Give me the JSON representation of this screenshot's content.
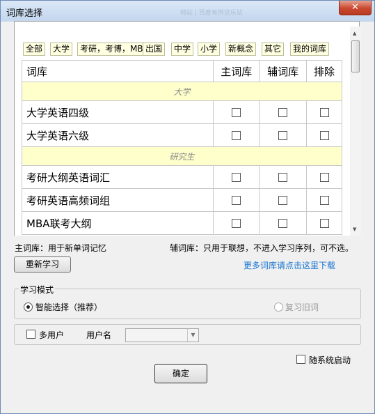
{
  "window": {
    "title": "词库选择",
    "ghost_text": "网站 | 百度有所见乐站",
    "close_glyph": "✕"
  },
  "filters": [
    "全部",
    "大学",
    "考研，考博，MBA",
    "出国",
    "中学",
    "小学",
    "新概念",
    "其它",
    "我的词库"
  ],
  "table": {
    "headers": {
      "name": "词库",
      "main": "主词库",
      "aux": "辅词库",
      "exclude": "排除"
    },
    "sections": [
      {
        "category": "大学",
        "rows": [
          "大学英语四级",
          "大学英语六级"
        ]
      },
      {
        "category": "研究生",
        "rows": [
          "考研大纲英语词汇",
          "考研英语高频词组",
          "MBA联考大纲"
        ]
      }
    ]
  },
  "notes": {
    "main": "主词库：用于新单词记忆",
    "aux": "辅词库：只用于联想，不进入学习序列，可不选。"
  },
  "relearn_button": "重新学习",
  "more_link": "更多词库请点击这里下载",
  "mode": {
    "legend": "学习模式",
    "smart": "智能选择（推荐）",
    "review": "复习旧词",
    "selected": "smart"
  },
  "user": {
    "multi_label": "多用户",
    "username_label": "用户名",
    "username_value": ""
  },
  "startup_label": "随系统启动",
  "ok_button": "确定"
}
